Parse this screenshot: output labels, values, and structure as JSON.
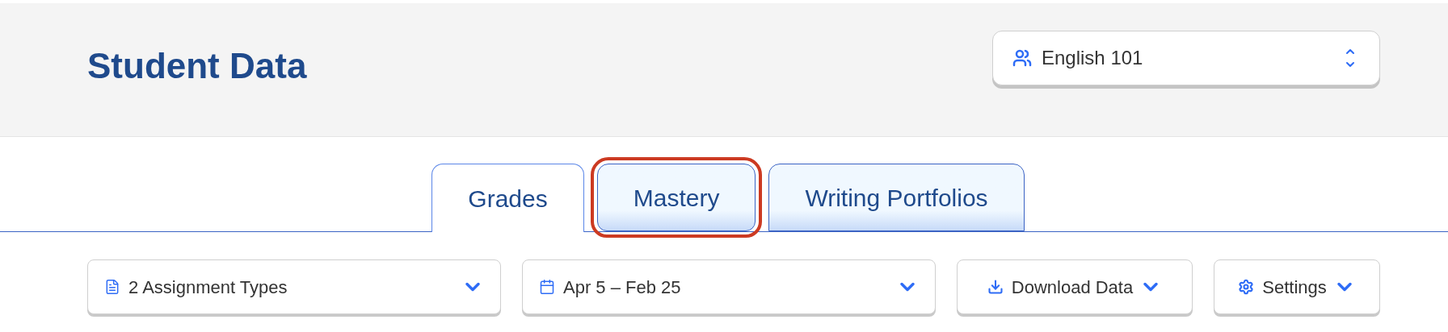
{
  "header": {
    "title": "Student Data",
    "class_select": {
      "value": "English 101"
    }
  },
  "tabs": [
    {
      "label": "Grades",
      "selected": true,
      "highlighted": false
    },
    {
      "label": "Mastery",
      "selected": false,
      "highlighted": true
    },
    {
      "label": "Writing Portfolios",
      "selected": false,
      "highlighted": false
    }
  ],
  "toolbar": [
    {
      "kind": "filter",
      "label": "2 Assignment Types"
    },
    {
      "kind": "date",
      "label": "Apr 5 – Feb 25"
    },
    {
      "kind": "download",
      "label": "Download Data"
    },
    {
      "kind": "settings",
      "label": "Settings"
    }
  ]
}
